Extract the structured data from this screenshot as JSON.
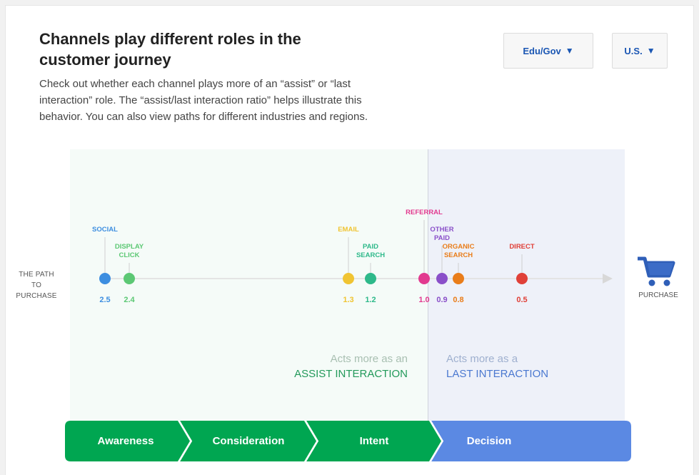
{
  "header": {
    "title": "Channels play different roles in the customer journey",
    "subtitle": "Check out whether each channel plays more of an “assist” or “last interaction” role. The “assist/last interaction ratio” helps illustrate this behavior. You can also view paths for different industries and regions."
  },
  "filters": {
    "industry": {
      "label": "Edu/Gov",
      "icon": "triangle-down-icon"
    },
    "region": {
      "label": "U.S.",
      "icon": "triangle-down-icon"
    }
  },
  "path": {
    "start_label": "THE PATH\nTO PURCHASE",
    "end_label": "PURCHASE",
    "end_icon": "shopping-cart-icon"
  },
  "channels": [
    {
      "name": "SOCIAL",
      "ratio": "2.5",
      "color": "#3d8ee0"
    },
    {
      "name": "DISPLAY\nCLICK",
      "ratio": "2.4",
      "color": "#5cc874"
    },
    {
      "name": "EMAIL",
      "ratio": "1.3",
      "color": "#f0c432"
    },
    {
      "name": "PAID\nSEARCH",
      "ratio": "1.2",
      "color": "#2eb98a"
    },
    {
      "name": "REFERRAL",
      "ratio": "1.0",
      "color": "#e23a8f"
    },
    {
      "name": "OTHER\nPAID",
      "ratio": "0.9",
      "color": "#8a4fc9"
    },
    {
      "name": "ORGANIC\nSEARCH",
      "ratio": "0.8",
      "color": "#e97d1a"
    },
    {
      "name": "DIRECT",
      "ratio": "0.5",
      "color": "#e04038"
    }
  ],
  "zones": {
    "assist": {
      "line1": "Acts more as an",
      "line2": "ASSIST INTERACTION"
    },
    "last": {
      "line1": "Acts more as a",
      "line2": "LAST INTERACTION"
    }
  },
  "stages": [
    {
      "label": "Awareness",
      "color": "#00a651"
    },
    {
      "label": "Consideration",
      "color": "#00a651"
    },
    {
      "label": "Intent",
      "color": "#00a651"
    },
    {
      "label": "Decision",
      "color": "#5b89e3"
    }
  ]
}
